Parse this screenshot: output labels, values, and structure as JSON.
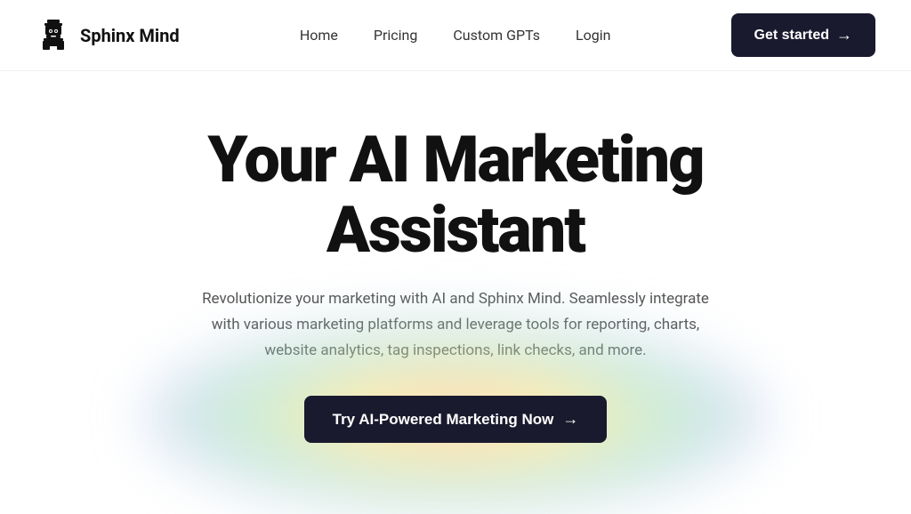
{
  "brand": {
    "name": "Sphinx Mind",
    "logo_alt": "Sphinx Mind Logo"
  },
  "nav": {
    "links": [
      {
        "label": "Home",
        "id": "home"
      },
      {
        "label": "Pricing",
        "id": "pricing"
      },
      {
        "label": "Custom GPTs",
        "id": "custom-gpts"
      },
      {
        "label": "Login",
        "id": "login"
      }
    ],
    "cta_label": "Get started",
    "cta_arrow": "→"
  },
  "hero": {
    "title": "Your AI Marketing Assistant",
    "subtitle": "Revolutionize your marketing with AI and Sphinx Mind. Seamlessly integrate with various marketing platforms and leverage tools for reporting, charts, website analytics, tag inspections, link checks, and more.",
    "cta_label": "Try AI-Powered Marketing Now",
    "cta_arrow": "→"
  }
}
